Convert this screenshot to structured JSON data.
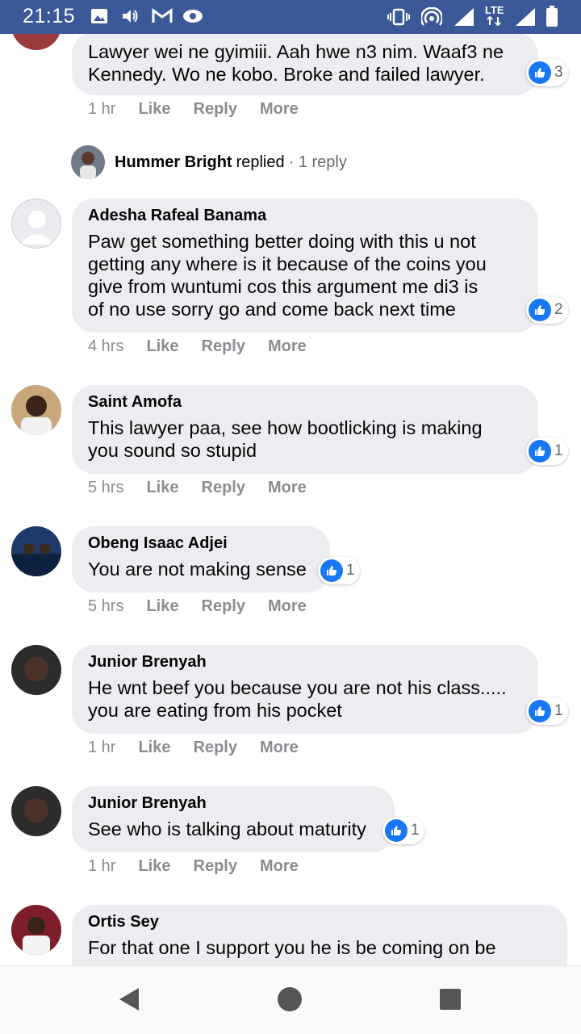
{
  "status_bar": {
    "time": "21:15",
    "network": "LTE"
  },
  "colors": {
    "status_bg": "#3b5998",
    "bubble_bg": "#ebedf0",
    "like_blue": "#1877f2",
    "meta_gray": "#8a8d91"
  },
  "actions": {
    "like": "Like",
    "reply": "Reply",
    "more": "More"
  },
  "comments": [
    {
      "name": "",
      "text": "Lawyer wei ne gyimiii. Aah hwe n3 nim. Waaf3 ne\nKennedy. Wo ne kobo. Broke and failed lawyer.",
      "likes": "3",
      "time": "1 hr"
    },
    {
      "name": "Adesha Rafeal Banama",
      "text": "Paw get something better doing with this u not\ngetting any where is it because of the coins you\ngive from wuntumi cos this argument me di3 is\nof no use sorry go and come back next time",
      "likes": "2",
      "time": "4 hrs"
    },
    {
      "name": "Saint Amofa",
      "text": "This lawyer paa, see how bootlicking is making\nyou sound so stupid",
      "likes": "1",
      "time": "5 hrs"
    },
    {
      "name": "Obeng Isaac Adjei",
      "text": "You are not making sense",
      "likes": "1",
      "time": "5 hrs"
    },
    {
      "name": "Junior Brenyah",
      "text": "He wnt beef you because you are not his class.....\nyou are eating from his pocket",
      "likes": "1",
      "time": "1 hr"
    },
    {
      "name": "Junior Brenyah",
      "text": "See who is talking about maturity",
      "likes": "1",
      "time": "1 hr"
    },
    {
      "name": "Ortis Sey",
      "text": "For that one I support you he is be coming on be"
    }
  ],
  "reply_summary": {
    "name": "Hummer Bright",
    "verb": "replied",
    "count": "· 1 reply"
  }
}
